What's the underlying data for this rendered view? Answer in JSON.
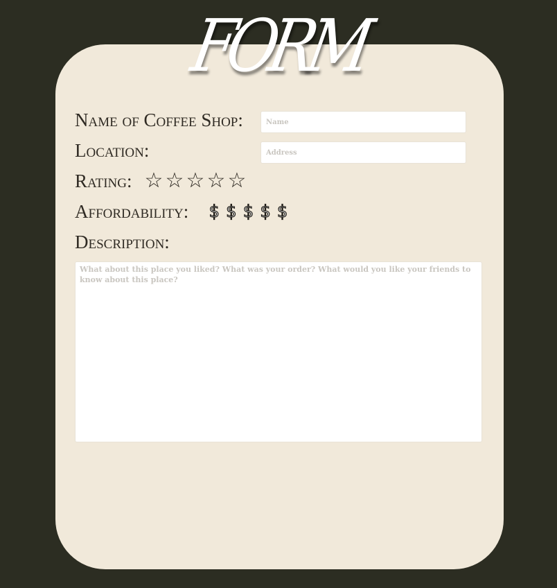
{
  "title": "FORM",
  "form": {
    "name_label": "Name of Coffee Shop:",
    "name_placeholder": "Name",
    "location_label": "Location:",
    "location_placeholder": "Address",
    "rating_label": "Rating:",
    "rating": {
      "value": 0,
      "max": 5,
      "stars": [
        "☆",
        "☆",
        "☆",
        "☆",
        "☆"
      ]
    },
    "affordability_label": "Affordability:",
    "affordability": {
      "value": 0,
      "max": 5,
      "symbols": [
        "$",
        "$",
        "$",
        "$",
        "$"
      ]
    },
    "description_label": "Description:",
    "description_placeholder": "What about this place you liked? What was your order? What would you like your friends to know about this place?"
  },
  "colors": {
    "background": "#2c2d22",
    "card": "#f1e9da",
    "label_text": "#2f2a23",
    "title_text": "#ffffff",
    "placeholder_text": "#c9c6c0"
  },
  "icons": {
    "rating": "empty-star-icon",
    "affordability": "dollar-icon"
  }
}
